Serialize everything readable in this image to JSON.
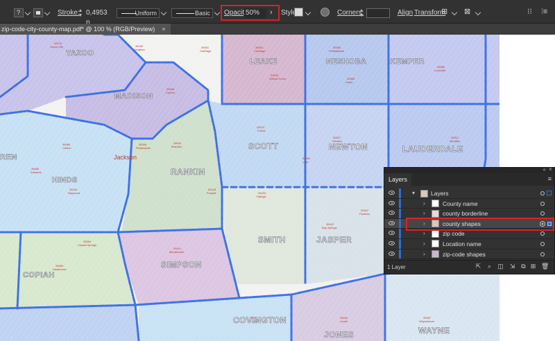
{
  "toolbar": {
    "question_icon": "?",
    "stroke_label": "Stroke:",
    "stroke_value": "0,4953 p",
    "profile_label": "Uniform",
    "brush_label": "Basic",
    "opacity_label": "Opacity:",
    "opacity_value": "50%",
    "style_label": "Style:",
    "corners_label": "Corners:",
    "align_label": "Align",
    "transform_label": "Transform"
  },
  "document_tab": {
    "title": "zip-code-city-county-map.pdf* @ 100 % (RGB/Preview)",
    "close": "×"
  },
  "map": {
    "counties": [
      "YAZOO",
      "LEAKE",
      "NESHOBA",
      "KEMPER",
      "MADISON",
      "SCOTT",
      "NEWTON",
      "LAUDERDALE",
      "REN",
      "HINDS",
      "RANKIN",
      "SMITH",
      "JASPER",
      "COPIAH",
      "SIMPSON",
      "COVINGTON",
      "JONES",
      "WAYNE"
    ],
    "cities": [
      "Jackson",
      "Vaughan",
      "Carthage",
      "Philadelphia",
      "Canton",
      "Forest",
      "Decatur",
      "Meridian",
      "Brandon",
      "Pelahatchie",
      "Bay Springs",
      "Mendenhall",
      "Collins",
      "Laurel",
      "Waynesboro",
      "Hazlehurst",
      "Crystal Springs",
      "Raleigh",
      "Pachuta",
      "Clinton",
      "Edwards",
      "Raymond",
      "Puckett",
      "Lake",
      "Union",
      "Louisville"
    ]
  },
  "layers_panel": {
    "tab": "Layers",
    "menu_icon": "≡",
    "collapse_icon": "«",
    "close_icon": "×",
    "footer_count": "1 Layer",
    "rows": [
      {
        "name": "Layers",
        "expanded": true
      },
      {
        "name": "County name"
      },
      {
        "name": "county borderline"
      },
      {
        "name": "county shapes",
        "selected": true
      },
      {
        "name": "zip code"
      },
      {
        "name": "Location name"
      },
      {
        "name": "zip-code shapes"
      }
    ]
  },
  "colors": {
    "highlight": "#d9222a",
    "selection_blue": "#2d6fd8",
    "border_blue": "#3f72e6"
  }
}
